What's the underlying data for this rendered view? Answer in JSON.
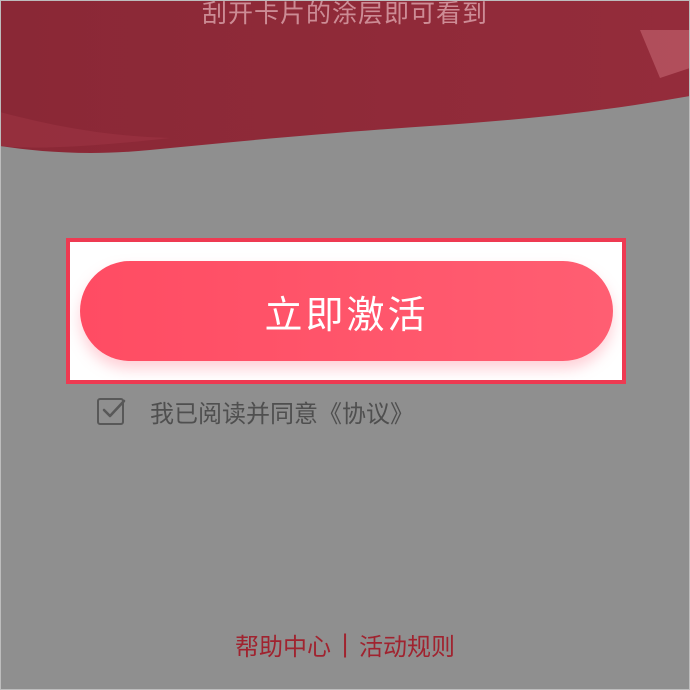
{
  "header": {
    "instruction_text": "刮开卡片的涂层即可看到"
  },
  "activate": {
    "label": "立即激活"
  },
  "agreement": {
    "text": "我已阅读并同意《协议》",
    "checked": true
  },
  "footer": {
    "help_label": "帮助中心",
    "separator": "|",
    "rules_label": "活动规则"
  },
  "colors": {
    "header_red": "#8e2b39",
    "button_red": "#ff5266",
    "highlight_border": "#ee3a52",
    "footer_text": "#a0232f",
    "backdrop_gray": "#8f8f8f"
  }
}
